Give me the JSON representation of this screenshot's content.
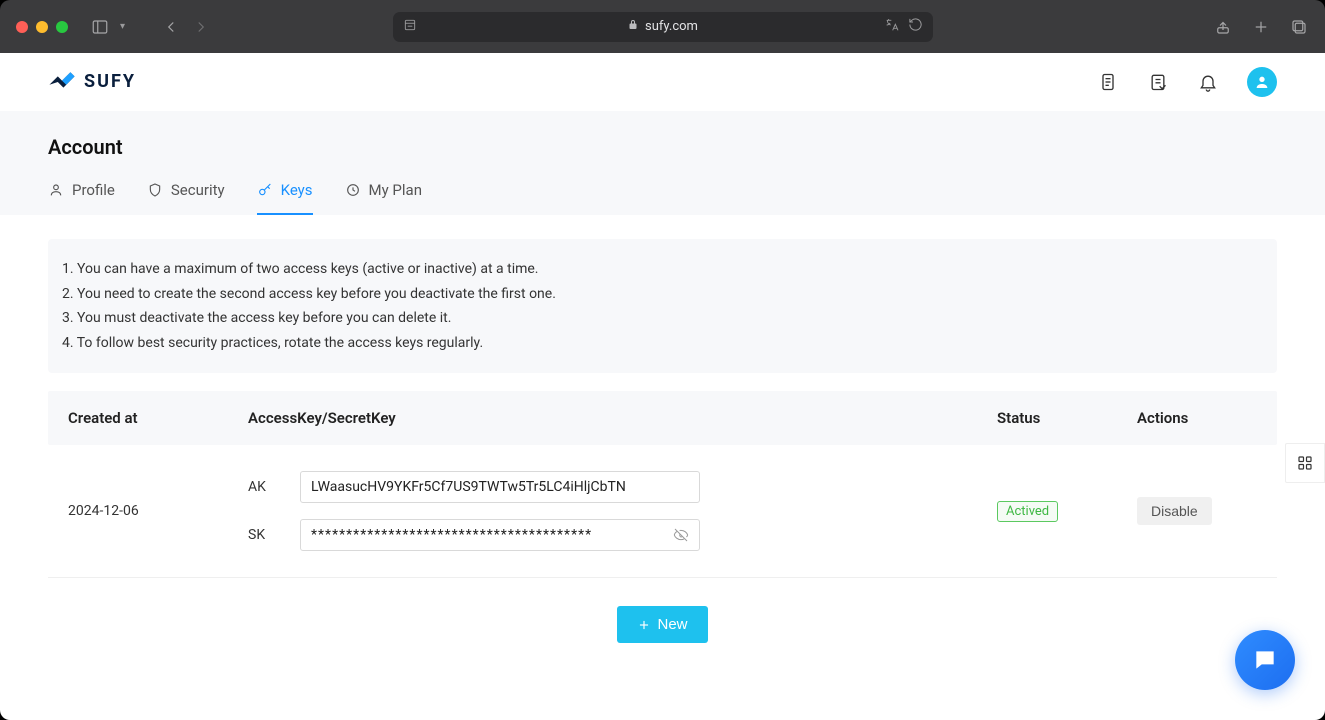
{
  "browser": {
    "domain": "sufy.com"
  },
  "brand": "SUFY",
  "header_icons": [
    "document",
    "notepad",
    "bell",
    "avatar"
  ],
  "page_title": "Account",
  "tabs": [
    {
      "id": "profile",
      "label": "Profile",
      "icon": "user"
    },
    {
      "id": "security",
      "label": "Security",
      "icon": "shield"
    },
    {
      "id": "keys",
      "label": "Keys",
      "icon": "key",
      "active": true
    },
    {
      "id": "myplan",
      "label": "My Plan",
      "icon": "clock"
    }
  ],
  "notice": [
    "1. You can have a maximum of two access keys (active or inactive) at a time.",
    "2. You need to create the second access key before you deactivate the first one.",
    "3. You must deactivate the access key before you can delete it.",
    "4. To follow best security practices, rotate the access keys regularly."
  ],
  "table": {
    "headers": {
      "created": "Created at",
      "keys": "AccessKey/SecretKey",
      "status": "Status",
      "actions": "Actions"
    },
    "rows": [
      {
        "created": "2024-12-06",
        "ak_label": "AK",
        "ak_value": "LWaasucHV9YKFr5Cf7US9TWTw5Tr5LC4iHljCbTN",
        "sk_label": "SK",
        "sk_value": "****************************************",
        "status": "Actived",
        "action": "Disable"
      }
    ]
  },
  "new_button": "New"
}
